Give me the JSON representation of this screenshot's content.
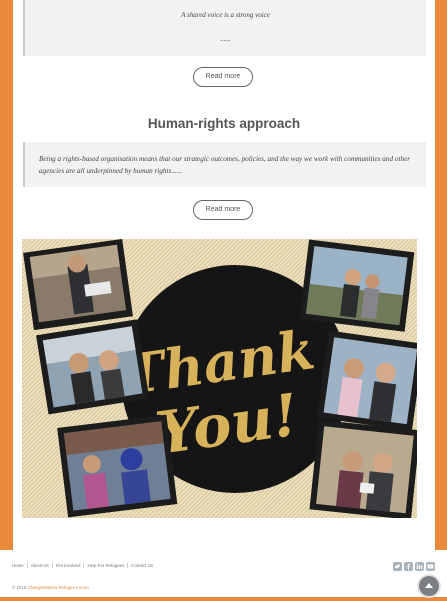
{
  "intro": {
    "quote_line1": "A shared voice is a strong voice",
    "quote_line2": "......",
    "read_more": "Read more"
  },
  "section": {
    "title": "Human-rights approach",
    "quote": "Being a rights-based organisation means that our strategic outcomes, policies, and the way we work with communities and other agencies are all underpinned by human rights......",
    "read_more": "Read more"
  },
  "banner": {
    "line1": "Thank",
    "line2": "You!"
  },
  "footer": {
    "nav": [
      "Home",
      "About Us",
      "Get Involved",
      "Help For Refugees",
      "Contact Us"
    ],
    "copyright_prefix": "© 2019 ",
    "copyright_org": "ChangeMakers Refugee Forum",
    "social_icons": [
      "twitter-icon",
      "facebook-icon",
      "linkedin-icon",
      "youtube-icon"
    ]
  },
  "colors": {
    "frame": "#e8893c",
    "gold": "#d8b25a",
    "circle": "#151515"
  }
}
